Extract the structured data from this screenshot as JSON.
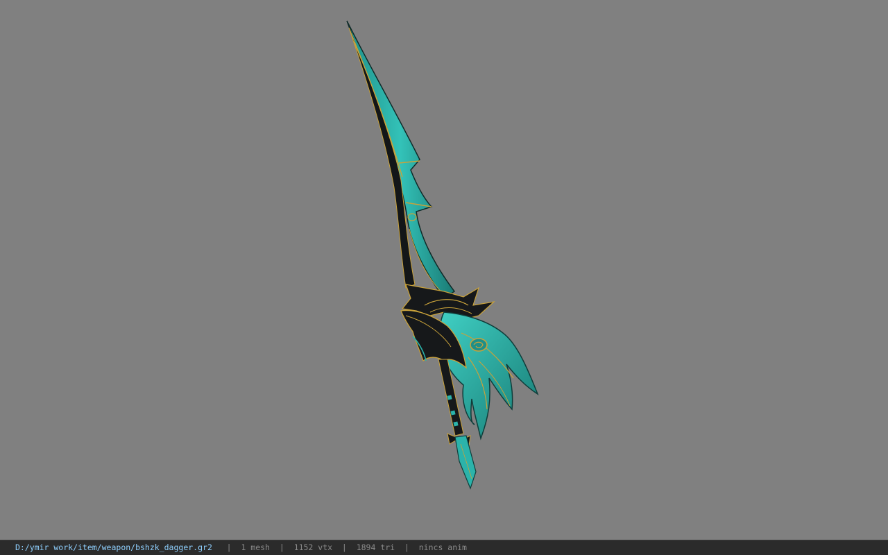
{
  "viewport": {
    "background": "#808080",
    "model_accent_color": "#2bb3aa",
    "model_trim_color": "#c9a23a",
    "model_dark_color": "#16181a"
  },
  "status_bar": {
    "file_path": "D:/ymir work/item/weapon/bshzk_dagger.gr2",
    "separator": "|",
    "mesh_count": "1 mesh",
    "vertex_count": "1152 vtx",
    "triangle_count": "1894 tri",
    "animation": "nincs anim",
    "path_color": "#8fd0ff",
    "text_color": "#8a8a8a"
  }
}
